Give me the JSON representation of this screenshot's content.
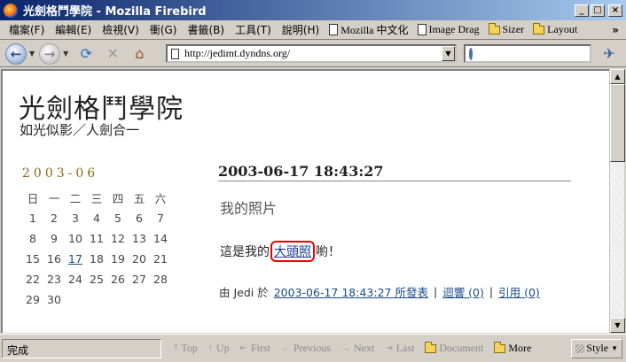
{
  "window": {
    "title": "光劍格鬥學院 - Mozilla Firebird"
  },
  "menubar": {
    "items": [
      "檔案(F)",
      "編輯(E)",
      "檢視(V)",
      "衝(G)",
      "書籤(B)",
      "工具(T)",
      "說明(H)"
    ],
    "bookmarks": [
      {
        "label": "Mozilla 中文化",
        "icon": "page-icon"
      },
      {
        "label": "Image Drag",
        "icon": "page-icon"
      },
      {
        "label": "Sizer",
        "icon": "folder-icon"
      },
      {
        "label": "Layout",
        "icon": "folder-icon"
      }
    ],
    "overflow": "»"
  },
  "toolbar": {
    "address": "http://jedimt.dyndns.org/",
    "search_value": ""
  },
  "page": {
    "site_title": "光劍格鬥學院",
    "site_subtitle": "如光似影／人劍合一",
    "calendar": {
      "month": "2003-06",
      "weekdays": [
        "日",
        "一",
        "二",
        "三",
        "四",
        "五",
        "六"
      ],
      "weeks": [
        [
          "1",
          "2",
          "3",
          "4",
          "5",
          "6",
          "7"
        ],
        [
          "8",
          "9",
          "10",
          "11",
          "12",
          "13",
          "14"
        ],
        [
          "15",
          "16",
          "17",
          "18",
          "19",
          "20",
          "21"
        ],
        [
          "22",
          "23",
          "24",
          "25",
          "26",
          "27",
          "28"
        ],
        [
          "29",
          "30",
          "",
          "",
          "",
          "",
          ""
        ]
      ],
      "linked_day": "17"
    },
    "post": {
      "date": "2003-06-17 18:43:27",
      "title": "我的照片",
      "body_before": "這是我的",
      "body_link": "大頭照",
      "body_after": "喲！",
      "meta_by": "由 Jedi 於",
      "meta_permalink": "2003-06-17 18:43:27 所發表",
      "meta_comments": "迴響 (0)",
      "meta_trackback": "引用 (0)",
      "meta_sep": "|"
    }
  },
  "statusbar": {
    "status": "完成",
    "links": [
      {
        "label": "Top",
        "icon": "arrow-top-icon",
        "enabled": false
      },
      {
        "label": "Up",
        "icon": "arrow-up-icon",
        "enabled": false
      },
      {
        "label": "First",
        "icon": "arrow-first-icon",
        "enabled": false
      },
      {
        "label": "Previous",
        "icon": "arrow-previous-icon",
        "enabled": false
      },
      {
        "label": "Next",
        "icon": "arrow-next-icon",
        "enabled": false
      },
      {
        "label": "Last",
        "icon": "arrow-last-icon",
        "enabled": false
      },
      {
        "label": "Document",
        "icon": "folder-icon",
        "enabled": false
      },
      {
        "label": "More",
        "icon": "folder-icon",
        "enabled": true
      }
    ],
    "style_label": "Style"
  },
  "colors": {
    "titlebar_start": "#0a246a",
    "titlebar_end": "#a6caf0",
    "link": "#1a4a8a",
    "calendar_heading": "#8a6a12",
    "highlight_box": "#e00000"
  }
}
